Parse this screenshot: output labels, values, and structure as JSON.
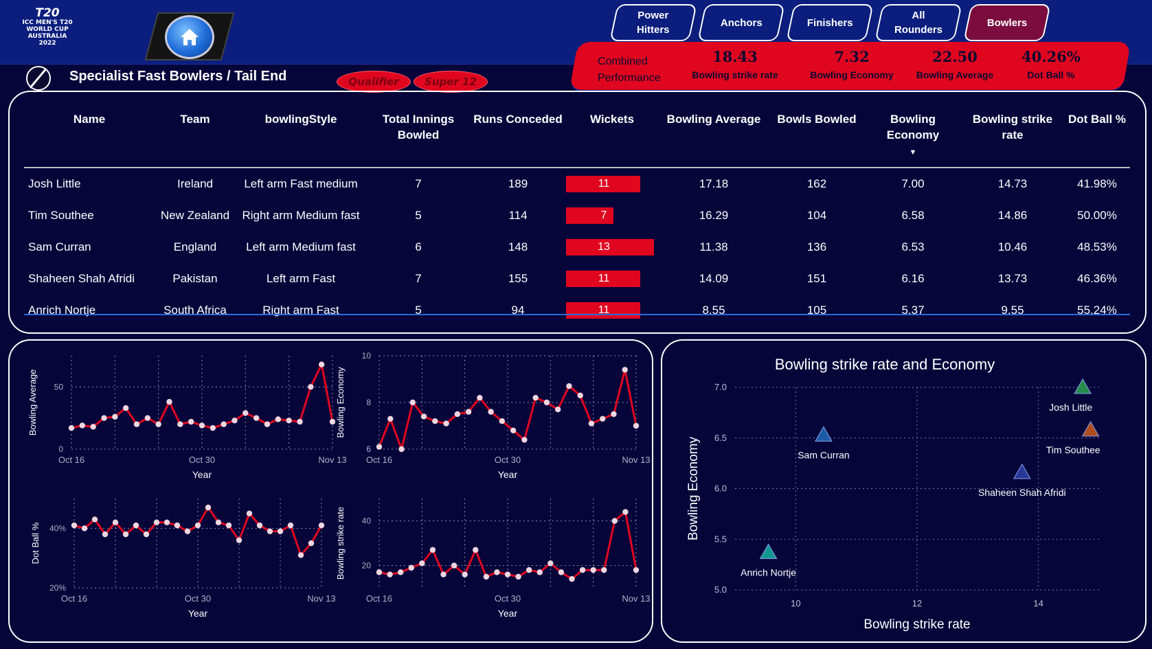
{
  "header": {
    "logo": {
      "line1": "T20",
      "line2": "ICC MEN'S T20",
      "line3": "WORLD CUP",
      "line4": "AUSTRALIA 2022"
    },
    "nav": [
      {
        "line1": "Power",
        "line2": "Hitters",
        "active": false
      },
      {
        "line1": "Anchors",
        "line2": "",
        "active": false
      },
      {
        "line1": "Finishers",
        "line2": "",
        "active": false
      },
      {
        "line1": "All",
        "line2": "Rounders",
        "active": false
      },
      {
        "line1": "Bowlers",
        "line2": "",
        "active": true
      }
    ],
    "kpi_label_1": "Combined",
    "kpi_label_2": "Performance",
    "kpis": [
      {
        "value": "18.43",
        "label": "Bowling strike rate"
      },
      {
        "value": "7.32",
        "label": "Bowling Economy"
      },
      {
        "value": "22.50",
        "label": "Bowling Average"
      },
      {
        "value": "40.26%",
        "label": "Dot Ball %"
      }
    ]
  },
  "page_title": "Specialist Fast Bowlers / Tail End",
  "filters": [
    "Qualifier",
    "Super 12"
  ],
  "table": {
    "columns": [
      "Name",
      "Team",
      "bowlingStyle",
      "Total Innings Bowled",
      "Runs Conceded",
      "Wickets",
      "Bowling Average",
      "Bowls Bowled",
      "Bowling Economy",
      "Bowling strike rate",
      "Dot Ball %"
    ],
    "rows": [
      [
        "Josh Little",
        "Ireland",
        "Left arm Fast medium",
        "7",
        "189",
        "11",
        "17.18",
        "162",
        "7.00",
        "14.73",
        "41.98%"
      ],
      [
        "Tim Southee",
        "New Zealand",
        "Right arm Medium fast",
        "5",
        "114",
        "7",
        "16.29",
        "104",
        "6.58",
        "14.86",
        "50.00%"
      ],
      [
        "Sam Curran",
        "England",
        "Left arm Medium fast",
        "6",
        "148",
        "13",
        "11.38",
        "136",
        "6.53",
        "10.46",
        "48.53%"
      ],
      [
        "Shaheen Shah Afridi",
        "Pakistan",
        "Left arm Fast",
        "7",
        "155",
        "11",
        "14.09",
        "151",
        "6.16",
        "13.73",
        "46.36%"
      ],
      [
        "Anrich Nortje",
        "South Africa",
        "Right arm Fast",
        "5",
        "94",
        "11",
        "8.55",
        "105",
        "5.37",
        "9.55",
        "55.24%"
      ]
    ]
  },
  "chart_data": [
    {
      "type": "line",
      "xlabel": "Year",
      "ylabel": "Bowling Average",
      "x_ticks": [
        "Oct 16",
        "Oct 30",
        "Nov 13"
      ],
      "y_ticks": [
        0,
        50
      ],
      "ylim": [
        0,
        75
      ],
      "series": [
        {
          "values": [
            17,
            19,
            18,
            25,
            26,
            33,
            20,
            25,
            20,
            38,
            20,
            22,
            19,
            17,
            20,
            23,
            29,
            25,
            20,
            24,
            23,
            22,
            50,
            68,
            22
          ]
        }
      ]
    },
    {
      "type": "line",
      "xlabel": "Year",
      "ylabel": "Bowling Economy",
      "x_ticks": [
        "Oct 16",
        "Oct 30",
        "Nov 13"
      ],
      "y_ticks": [
        6,
        8,
        10
      ],
      "ylim": [
        6,
        10
      ],
      "series": [
        {
          "values": [
            6.1,
            7.3,
            6.0,
            8.0,
            7.4,
            7.2,
            7.1,
            7.5,
            7.6,
            8.2,
            7.6,
            7.2,
            6.8,
            6.4,
            8.2,
            8.0,
            7.7,
            8.7,
            8.3,
            7.1,
            7.3,
            7.5,
            9.4,
            7.0
          ]
        }
      ]
    },
    {
      "type": "line",
      "xlabel": "Year",
      "ylabel": "Dot Ball %",
      "x_ticks": [
        "Oct 16",
        "Oct 30",
        "Nov 13"
      ],
      "y_ticks": [
        "20%",
        "40%"
      ],
      "ylim": [
        20,
        50
      ],
      "series": [
        {
          "values": [
            41,
            40,
            43,
            38,
            42,
            38,
            41,
            38,
            42,
            42,
            41,
            39,
            41,
            47,
            42,
            41,
            36,
            45,
            41,
            39,
            39,
            41,
            31,
            35,
            41
          ]
        }
      ]
    },
    {
      "type": "line",
      "xlabel": "Year",
      "ylabel": "Bowling strike rate",
      "x_ticks": [
        "Oct 16",
        "Oct 30",
        "Nov 13"
      ],
      "y_ticks": [
        20,
        40
      ],
      "ylim": [
        10,
        50
      ],
      "series": [
        {
          "values": [
            17,
            16,
            17,
            19,
            21,
            27,
            16,
            20,
            16,
            27,
            15,
            17,
            16,
            15,
            18,
            17,
            21,
            17,
            14,
            18,
            18,
            18,
            40,
            44,
            18
          ]
        }
      ]
    },
    {
      "type": "scatter",
      "title": "Bowling strike rate and Economy",
      "xlabel": "Bowling strike rate",
      "ylabel": "Bowling Economy",
      "xlim": [
        9,
        15
      ],
      "ylim": [
        5.0,
        7.0
      ],
      "x_ticks": [
        10,
        12,
        14
      ],
      "y_ticks": [
        "5.0",
        "5.5",
        "6.0",
        "6.5",
        "7.0"
      ],
      "points": [
        {
          "name": "Josh Little",
          "x": 14.73,
          "y": 7.0,
          "color": "#2a9a50"
        },
        {
          "name": "Tim Southee",
          "x": 14.86,
          "y": 6.58,
          "color": "#c2571a"
        },
        {
          "name": "Sam Curran",
          "x": 10.46,
          "y": 6.53,
          "color": "#1f63b0"
        },
        {
          "name": "Shaheen Shah Afridi",
          "x": 13.73,
          "y": 6.16,
          "color": "#2b3fa0"
        },
        {
          "name": "Anrich Nortje",
          "x": 9.55,
          "y": 5.37,
          "color": "#14a99a"
        }
      ]
    }
  ],
  "colors": {
    "background": "#05053a",
    "header": "#0b1e7e",
    "accent": "#e0061f",
    "active_tab": "#7a0d3e"
  }
}
